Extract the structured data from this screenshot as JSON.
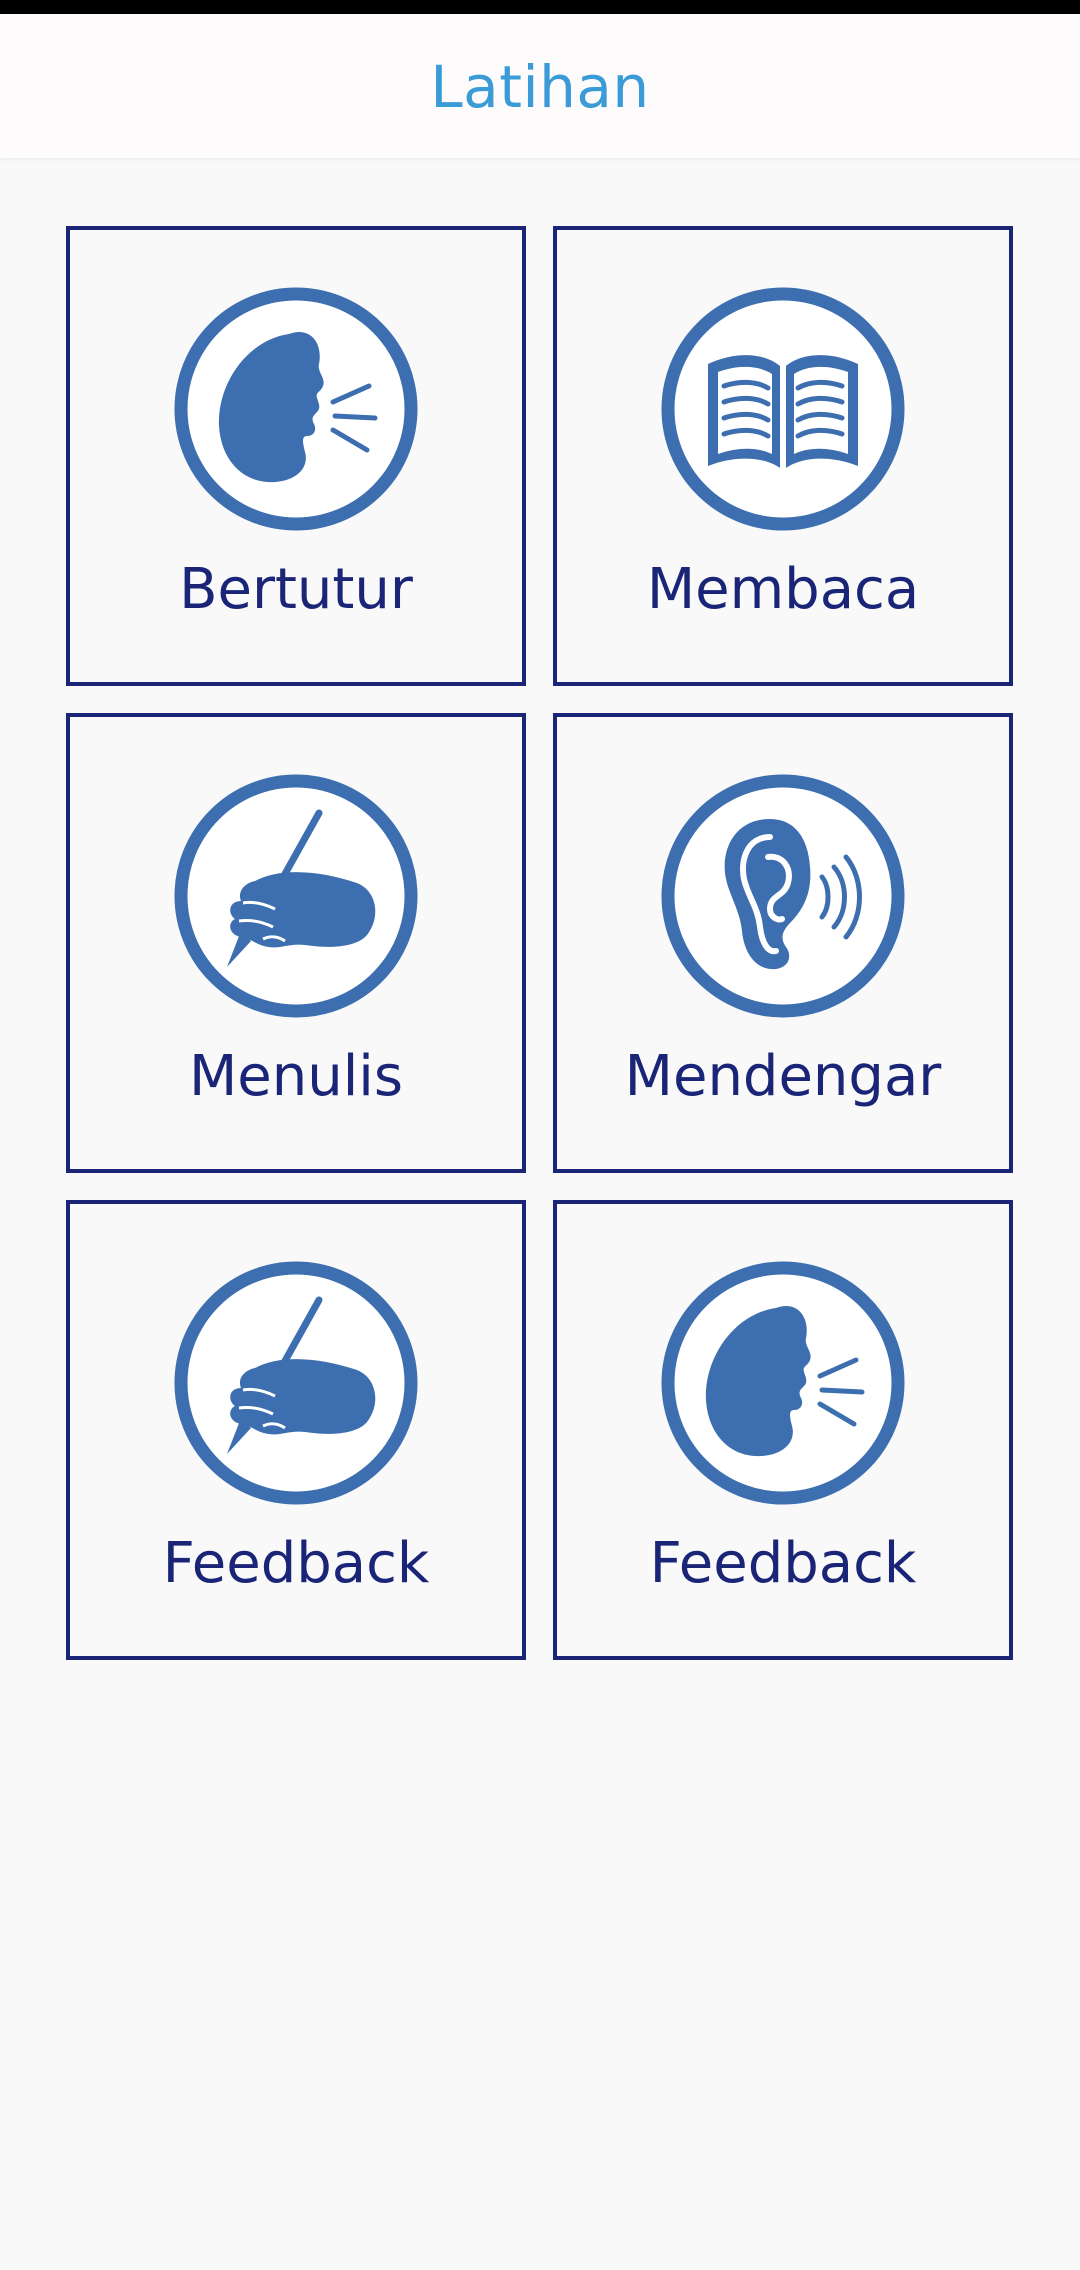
{
  "app_bar": {
    "title": "Latihan"
  },
  "colors": {
    "title": "#3b9bd6",
    "card_border": "#1a2578",
    "label": "#1a2578",
    "icon_blue": "#3d6fb0",
    "background": "#f9f9f9"
  },
  "cards": [
    {
      "label": "Bertutur",
      "icon": "speaking-head-icon"
    },
    {
      "label": "Membaca",
      "icon": "open-book-icon"
    },
    {
      "label": "Menulis",
      "icon": "writing-hand-icon"
    },
    {
      "label": "Mendengar",
      "icon": "listening-ear-icon"
    },
    {
      "label": "Feedback",
      "icon": "writing-hand-icon"
    },
    {
      "label": "Feedback",
      "icon": "speaking-head-icon"
    }
  ]
}
